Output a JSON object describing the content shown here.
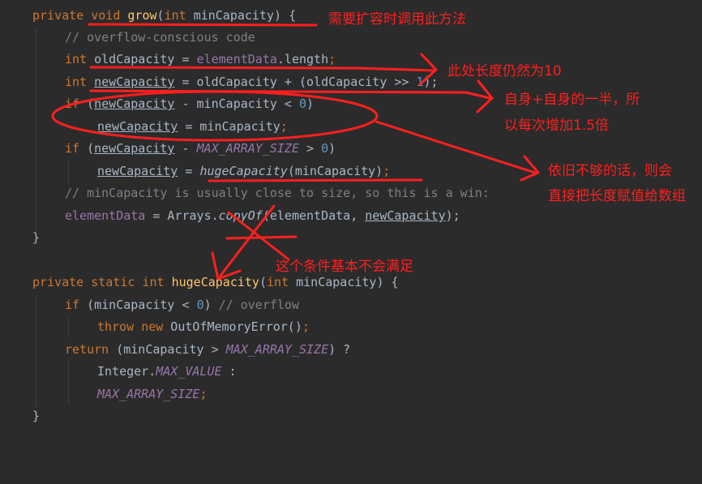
{
  "code": {
    "l1": {
      "kw1": "private",
      "kw2": "void",
      "name": "grow",
      "p1": "(",
      "kw3": "int",
      "param": "minCapacity",
      "p2": ") {"
    },
    "l2": {
      "comment": "// overflow-conscious code"
    },
    "l3": {
      "kw": "int",
      "var": "oldCapacity",
      "eq": " = ",
      "field": "elementData",
      "dot": ".length",
      "semi": ";"
    },
    "l4": {
      "kw": "int",
      "var": "newCapacity",
      "rest1": " = oldCapacity + (oldCapacity >> ",
      "num": "1",
      "rest2": ");"
    },
    "l5": {
      "kw": "if",
      "p1": " (",
      "var": "newCapacity",
      "rest": " - minCapacity < ",
      "num": "0",
      "p2": ")"
    },
    "l6": {
      "var": "newCapacity",
      "rest": " = minCapacity",
      "semi": ";"
    },
    "l7": {
      "kw": "if",
      "p1": " (",
      "var": "newCapacity",
      "rest": " - ",
      "field": "MAX_ARRAY_SIZE",
      "rest2": " > ",
      "num": "0",
      "p2": ")"
    },
    "l8": {
      "var": "newCapacity",
      "eq": " = ",
      "call": "hugeCapacity",
      "rest": "(minCapacity)",
      "semi": ";"
    },
    "l9": {
      "comment": "// minCapacity is usually close to size, so this is a win:"
    },
    "l10": {
      "field": "elementData",
      "rest1": " = Arrays.",
      "call": "copyOf",
      "rest2": "(elementData, ",
      "var": "newCapacity",
      "rest3": ");"
    },
    "l11": {
      "brace": "}"
    },
    "l12": {
      "kw1": "private",
      "kw2": "static",
      "kw3": "int",
      "name": "hugeCapacity",
      "p1": "(",
      "kw4": "int",
      "param": "minCapacity",
      "p2": ") {"
    },
    "l13": {
      "kw": "if",
      "rest": " (minCapacity < ",
      "num": "0",
      "p2": ") ",
      "comment": "// overflow"
    },
    "l14": {
      "kw1": "throw",
      "kw2": "new",
      "rest": " OutOfMemoryError()",
      "semi": ";"
    },
    "l15": {
      "kw": "return",
      "rest": " (minCapacity > ",
      "field": "MAX_ARRAY_SIZE",
      "rest2": ") ?"
    },
    "l16": {
      "rest": "Integer.",
      "field": "MAX_VALUE",
      "rest2": " :"
    },
    "l17": {
      "field": "MAX_ARRAY_SIZE",
      "semi": ";"
    },
    "l18": {
      "brace": "}"
    }
  },
  "annotations": {
    "a1": "需要扩容时调用此方法",
    "a2": "此处长度仍然为10",
    "a3_line1": "自身+自身的一半，所",
    "a3_line2": "以每次增加1.5倍",
    "a4_line1": "依旧不够的话，则会",
    "a4_line2": "直接把长度赋值给数组",
    "a5": "这个条件基本不会满足"
  },
  "colors": {
    "background": "#2b2b2b",
    "keyword": "#cc7832",
    "function": "#ffc66d",
    "field": "#9876aa",
    "number": "#6897bb",
    "comment": "#808080",
    "text": "#a9b7c6",
    "annotation": "#ff1f1f"
  }
}
